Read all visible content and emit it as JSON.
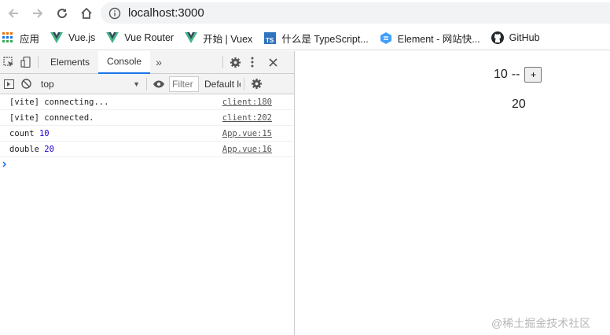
{
  "browser": {
    "url": "localhost:3000"
  },
  "bookmarks": [
    {
      "label": "应用",
      "icon": "apps-grid-icon"
    },
    {
      "label": "Vue.js",
      "icon": "vue-logo-icon"
    },
    {
      "label": "Vue Router",
      "icon": "vue-logo-icon"
    },
    {
      "label": "开始 | Vuex",
      "icon": "vue-logo-icon"
    },
    {
      "label": "什么是 TypeScript...",
      "icon": "typescript-logo-icon"
    },
    {
      "label": "Element - 网站快...",
      "icon": "element-logo-icon"
    },
    {
      "label": "GitHub",
      "icon": "github-logo-icon"
    }
  ],
  "devtools": {
    "tabs": {
      "elements": "Elements",
      "console": "Console"
    },
    "context": "top",
    "filter_placeholder": "Filter",
    "levels": "Default levels",
    "logs": [
      {
        "text": "[vite] connecting...",
        "value": "",
        "source": "client:180"
      },
      {
        "text": "[vite] connected.",
        "value": "",
        "source": "client:202"
      },
      {
        "text": "count",
        "value": "10",
        "source": "App.vue:15"
      },
      {
        "text": "double",
        "value": "20",
        "source": "App.vue:16"
      }
    ],
    "accent_color": "#1a73e8"
  },
  "app": {
    "count": "10",
    "separator": "--",
    "plus_label": "+",
    "double": "20"
  },
  "watermark": "@稀土掘金技术社区"
}
